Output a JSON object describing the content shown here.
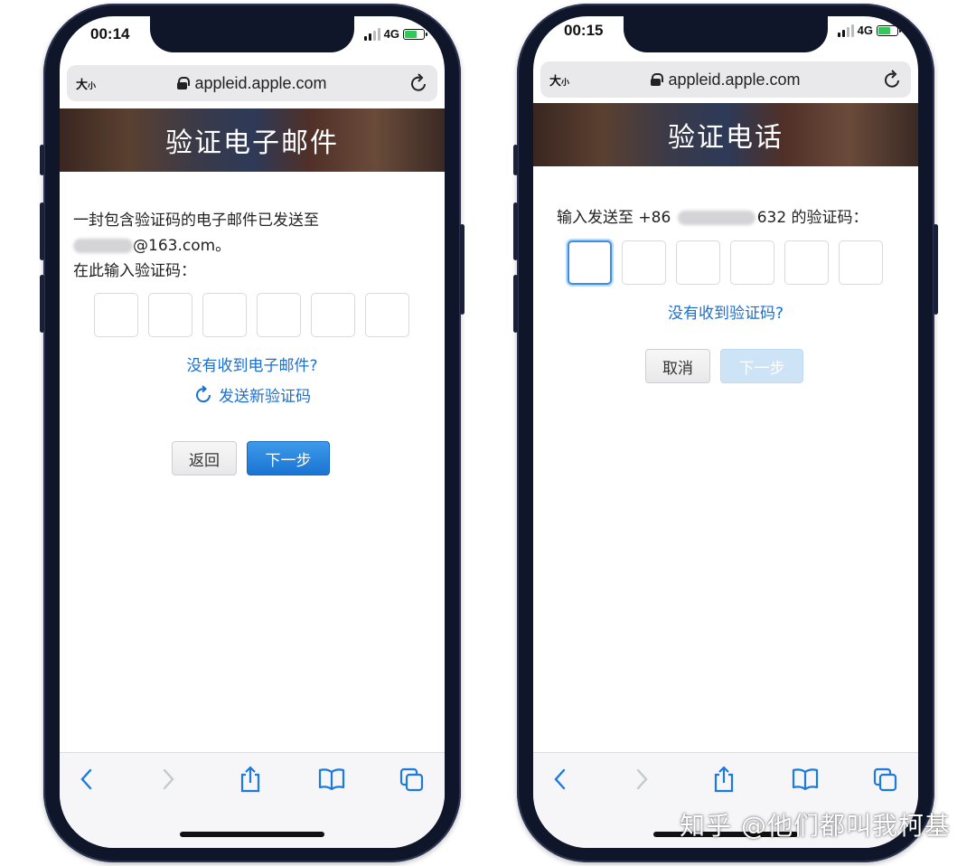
{
  "left_phone": {
    "status": {
      "time": "00:14",
      "network": "4G"
    },
    "browser": {
      "text_size_label_big": "大",
      "text_size_label_small": "小",
      "url": "appleid.apple.com"
    },
    "banner_title": "验证电子邮件",
    "message_line1": "一封包含验证码的电子邮件已发送至",
    "email_suffix": "@163.com。",
    "prompt": "在此输入验证码：",
    "code_digits": [
      "",
      "",
      "",
      "",
      "",
      ""
    ],
    "no_email_link": "没有收到电子邮件?",
    "resend_label": "发送新验证码",
    "back_button": "返回",
    "next_button": "下一步"
  },
  "right_phone": {
    "status": {
      "time": "00:15",
      "network": "4G"
    },
    "browser": {
      "text_size_label_big": "大",
      "text_size_label_small": "小",
      "url": "appleid.apple.com"
    },
    "banner_title": "验证电话",
    "prompt_prefix": "输入发送至 +86",
    "prompt_suffix": "632 的验证码：",
    "code_digits": [
      "",
      "",
      "",
      "",
      "",
      ""
    ],
    "no_code_link": "没有收到验证码?",
    "cancel_button": "取消",
    "next_button": "下一步"
  },
  "toolbar_icons": [
    "back-icon",
    "forward-icon",
    "share-icon",
    "bookmarks-icon",
    "tabs-icon"
  ],
  "watermark": "知乎 @他们都叫我柯基",
  "colors": {
    "link": "#1a6fcf",
    "primary_button": "#1a73d3",
    "phone_frame": "#10162a"
  }
}
